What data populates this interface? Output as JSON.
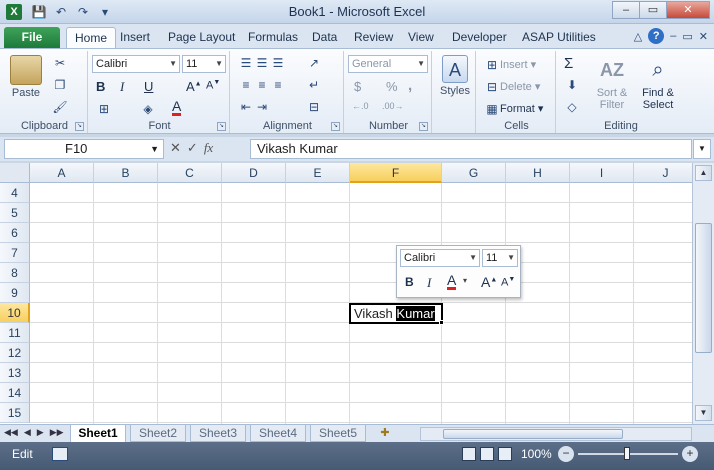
{
  "window": {
    "app_icon": "X",
    "title": "Book1  -  Microsoft Excel",
    "minimize": "–",
    "restore": "▭",
    "close": "✕"
  },
  "ribbon_tabs": [
    "File",
    "Home",
    "Insert",
    "Page Layout",
    "Formulas",
    "Data",
    "Review",
    "View",
    "Developer",
    "ASAP Utilities"
  ],
  "ribbon": {
    "clipboard": {
      "paste": "Paste",
      "label": "Clipboard"
    },
    "font": {
      "name": "Calibri",
      "size": "11",
      "label": "Font",
      "bold": "B",
      "italic": "I",
      "underline": "U"
    },
    "alignment": {
      "label": "Alignment"
    },
    "number": {
      "format": "General",
      "label": "Number",
      "currency": "$",
      "percent": "%",
      "comma": ","
    },
    "styles": {
      "label": "Styles"
    },
    "cells": {
      "insert": "Insert",
      "delete": "Delete",
      "format": "Format",
      "label": "Cells"
    },
    "editing": {
      "sort": "Sort &",
      "filter": "Filter",
      "find": "Find &",
      "select": "Select",
      "label": "Editing",
      "sigma": "Σ"
    }
  },
  "formula_bar": {
    "name_box": "F10",
    "fx": "fx",
    "content": "Vikash Kumar"
  },
  "grid": {
    "columns": [
      "A",
      "B",
      "C",
      "D",
      "E",
      "F",
      "G",
      "H",
      "I",
      "J"
    ],
    "selected_column": "F",
    "rows": [
      "4",
      "5",
      "6",
      "7",
      "8",
      "9",
      "10",
      "11",
      "12",
      "13",
      "14",
      "15"
    ],
    "selected_row": "10",
    "active_cell": {
      "plain_text": "Vikash ",
      "selected_text": "Kumar"
    }
  },
  "mini_toolbar": {
    "font": "Calibri",
    "size": "11",
    "bold": "B",
    "italic": "I",
    "font_color": "A",
    "grow": "A",
    "shrink": "A"
  },
  "sheets": [
    "Sheet1",
    "Sheet2",
    "Sheet3",
    "Sheet4",
    "Sheet5"
  ],
  "active_sheet": "Sheet1",
  "status_bar": {
    "mode": "Edit",
    "zoom": "100%",
    "zoom_out": "−",
    "zoom_in": "+"
  },
  "colors": {
    "file_tab": "#1d7a39",
    "selected_header": "#f8cf5e",
    "status_bar": "#475a74"
  }
}
